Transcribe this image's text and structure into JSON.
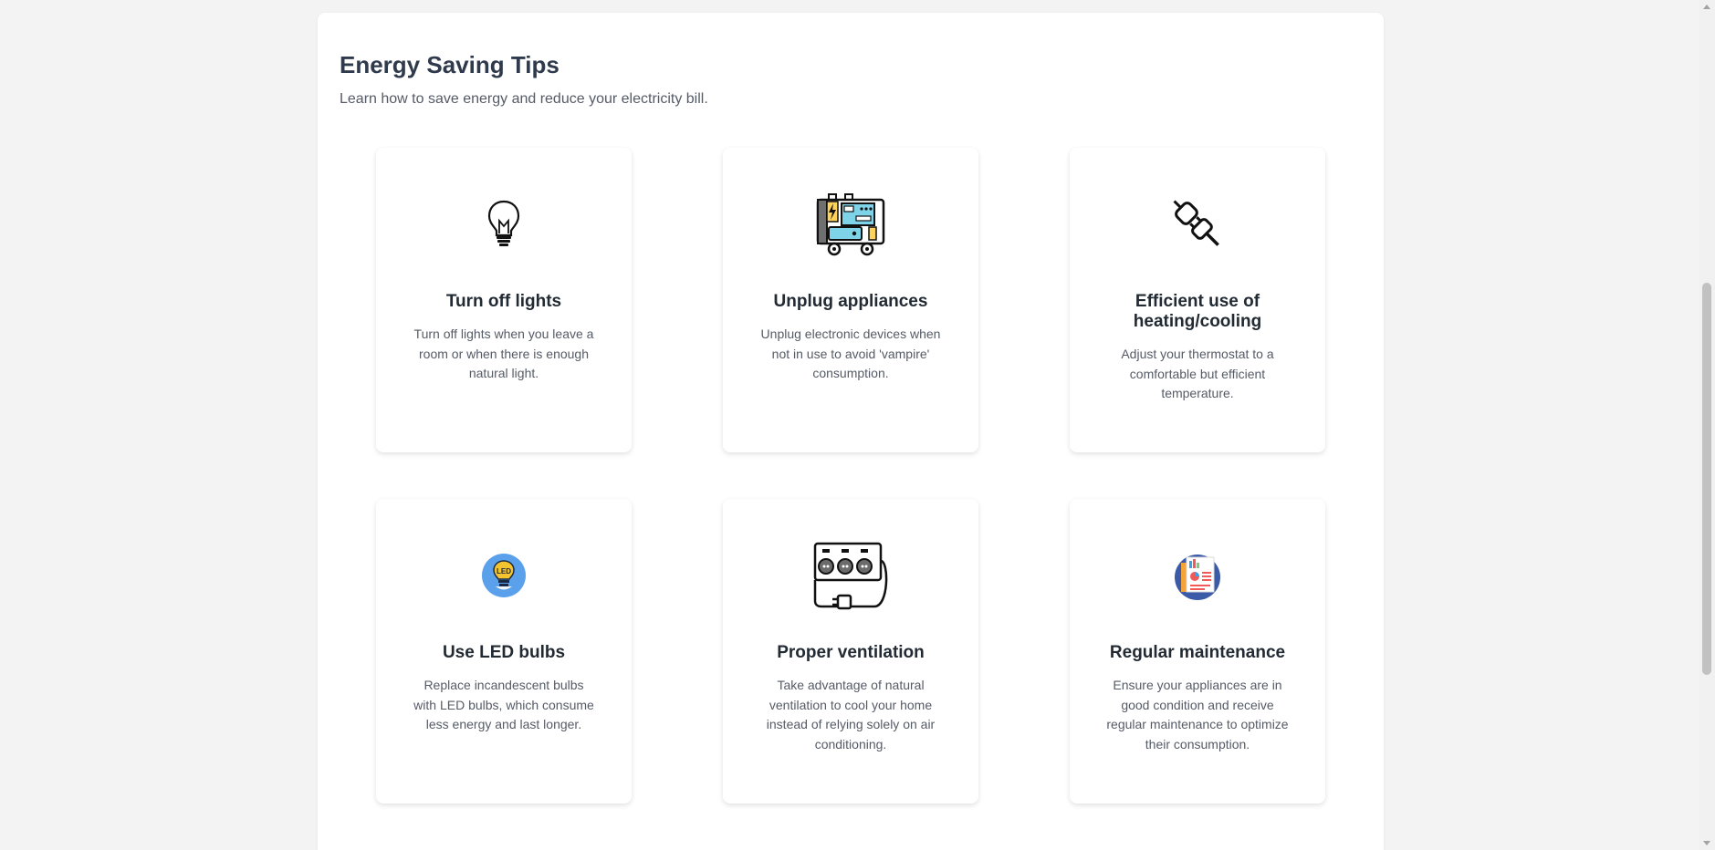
{
  "header": {
    "title": "Energy Saving Tips",
    "subtitle": "Learn how to save energy and reduce your electricity bill."
  },
  "tips": [
    {
      "icon": "lightbulb-icon",
      "title": "Turn off lights",
      "text": "Turn off lights when you leave a room or when there is enough natural light."
    },
    {
      "icon": "generator-icon",
      "title": "Unplug appliances",
      "text": "Unplug electronic devices when not in use to avoid 'vampire' consumption."
    },
    {
      "icon": "plug-icon",
      "title": "Efficient use of heating/cooling",
      "text": "Adjust your thermostat to a comfortable but efficient temperature."
    },
    {
      "icon": "led-bulb-icon",
      "title": "Use LED bulbs",
      "text": "Replace incandescent bulbs with LED bulbs, which consume less energy and last longer."
    },
    {
      "icon": "power-strip-icon",
      "title": "Proper ventilation",
      "text": "Take advantage of natural ventilation to cool your home instead of relying solely on air conditioning."
    },
    {
      "icon": "report-icon",
      "title": "Regular maintenance",
      "text": "Ensure your appliances are in good condition and receive regular maintenance to optimize their consumption."
    }
  ],
  "icon_labels": {
    "led": "LED"
  },
  "colors": {
    "title": "#2f3a4c",
    "card_title": "#222a33",
    "body_text": "#555b66",
    "background": "#f3f3f3",
    "panel": "#ffffff",
    "led_circle": "#5aa0ea",
    "bulb_yellow": "#f4c430",
    "generator_screen": "#7fd3e8"
  }
}
